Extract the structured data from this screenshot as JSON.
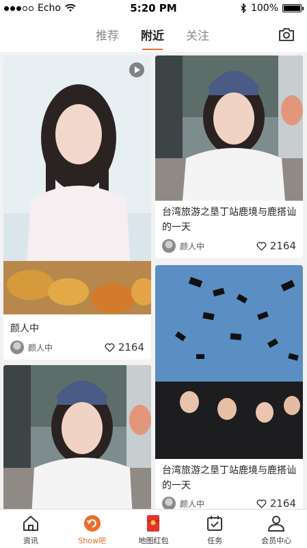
{
  "status": {
    "carrier": "Echo",
    "time": "5:20 PM",
    "battery": "100%",
    "battery_level": 1.0
  },
  "nav": {
    "tabs": [
      {
        "label": "推荐",
        "active": false
      },
      {
        "label": "附近",
        "active": true
      },
      {
        "label": "关注",
        "active": false
      }
    ],
    "accent": "#f06c2b"
  },
  "feed": {
    "cards": [
      {
        "title": "颜人中",
        "author": "颜人中",
        "likes": "2164",
        "video": true
      },
      {
        "title": "台湾旅游之垦丁站鹿境与鹿搭讪的一天",
        "author": "颜人中",
        "likes": "2164",
        "video": false
      },
      {
        "title": "台湾旅游之垦丁站鹿境与鹿搭讪的一天",
        "author": "颜人中",
        "likes": "2164",
        "video": false
      },
      {
        "title": "",
        "author": "",
        "likes": "",
        "video": false
      }
    ]
  },
  "tabbar": {
    "items": [
      {
        "label": "资讯",
        "icon": "home-icon",
        "active": false
      },
      {
        "label": "Show吧",
        "icon": "show-icon",
        "active": true
      },
      {
        "label": "地图红包",
        "icon": "red-envelope-icon",
        "active": false
      },
      {
        "label": "任务",
        "icon": "calendar-icon",
        "active": false
      },
      {
        "label": "会员中心",
        "icon": "user-icon",
        "active": false
      }
    ]
  }
}
